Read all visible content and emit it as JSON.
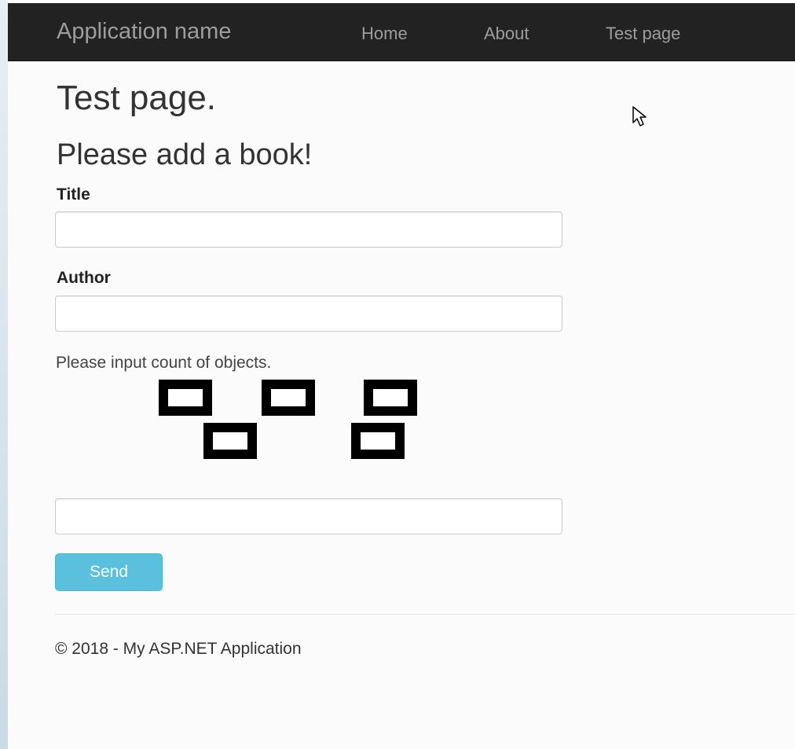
{
  "navbar": {
    "brand": "Application name",
    "links": [
      "Home",
      "About",
      "Test page"
    ]
  },
  "main": {
    "title": "Test page.",
    "subtitle": "Please add a book!",
    "form": {
      "title_label": "Title",
      "title_value": "",
      "author_label": "Author",
      "author_value": "",
      "captcha_prompt": "Please input count of objects.",
      "captcha_answer": "",
      "send_label": "Send"
    }
  },
  "footer": {
    "text": "© 2018 - My ASP.NET Application"
  },
  "colors": {
    "navbar": "#222222",
    "nav_text": "#9d9d9d",
    "send_button": "#5bc0de"
  },
  "icons": {
    "cursor": "mouse-pointer-icon",
    "captcha_objects": "square-icon"
  }
}
